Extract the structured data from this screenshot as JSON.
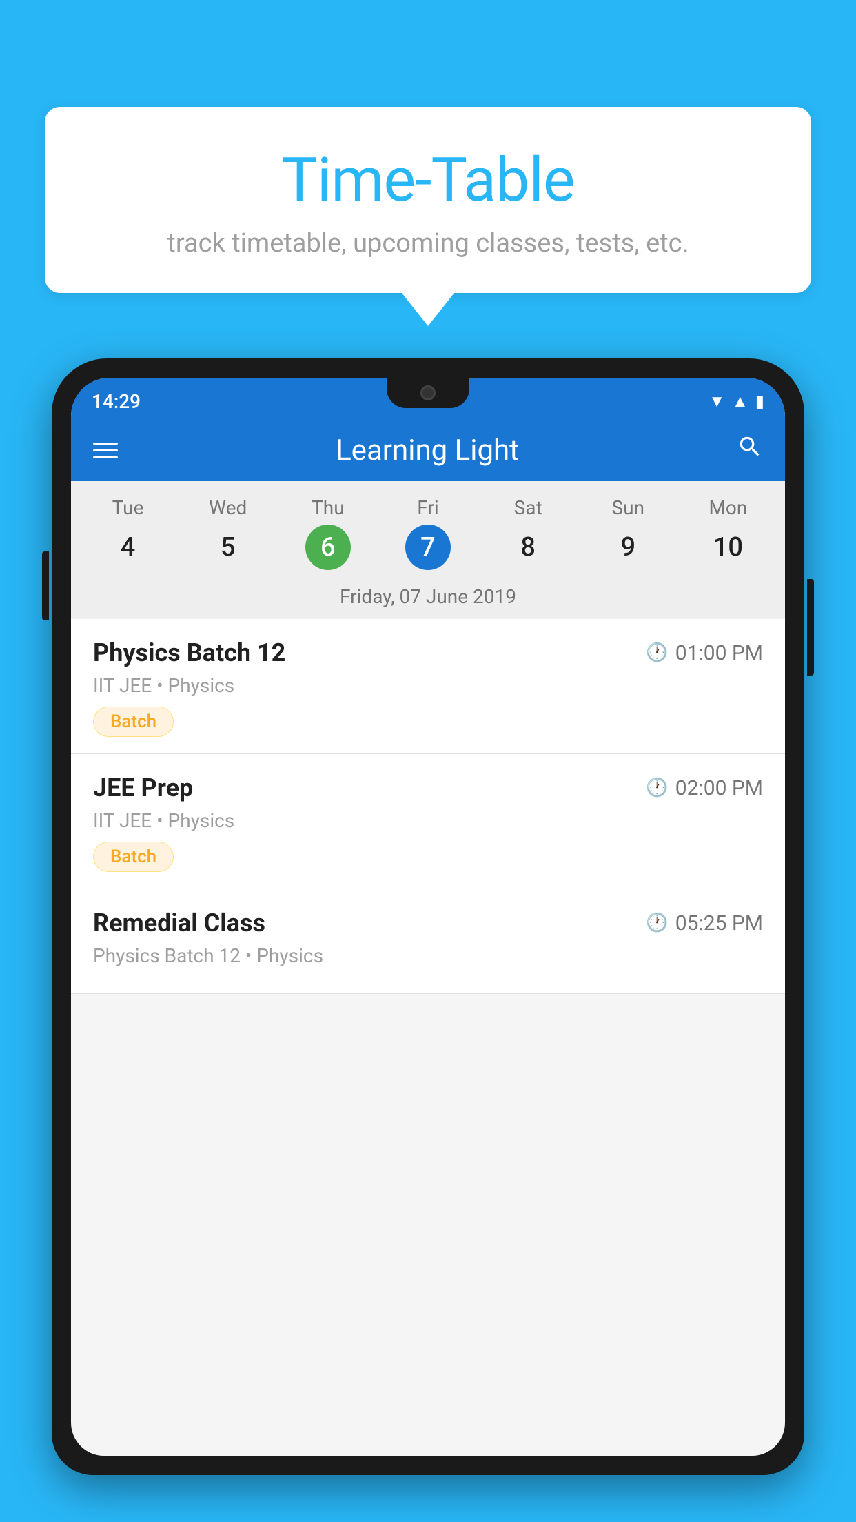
{
  "background": {
    "color": "#29B6F6"
  },
  "speech_bubble": {
    "title": "Time-Table",
    "subtitle": "track timetable, upcoming classes, tests, etc."
  },
  "phone": {
    "status_bar": {
      "time": "14:29"
    },
    "header": {
      "title": "Learning Light",
      "menu_icon": "≡",
      "search_icon": "🔍"
    },
    "calendar": {
      "days": [
        {
          "name": "Tue",
          "number": "4",
          "state": "normal"
        },
        {
          "name": "Wed",
          "number": "5",
          "state": "normal"
        },
        {
          "name": "Thu",
          "number": "6",
          "state": "today"
        },
        {
          "name": "Fri",
          "number": "7",
          "state": "selected"
        },
        {
          "name": "Sat",
          "number": "8",
          "state": "normal"
        },
        {
          "name": "Sun",
          "number": "9",
          "state": "normal"
        },
        {
          "name": "Mon",
          "number": "10",
          "state": "normal"
        }
      ],
      "selected_date_label": "Friday, 07 June 2019"
    },
    "schedule_items": [
      {
        "title": "Physics Batch 12",
        "time": "01:00 PM",
        "subtitle": "IIT JEE • Physics",
        "badge": "Batch"
      },
      {
        "title": "JEE Prep",
        "time": "02:00 PM",
        "subtitle": "IIT JEE • Physics",
        "badge": "Batch"
      },
      {
        "title": "Remedial Class",
        "time": "05:25 PM",
        "subtitle": "Physics Batch 12 • Physics",
        "badge": null
      }
    ]
  }
}
